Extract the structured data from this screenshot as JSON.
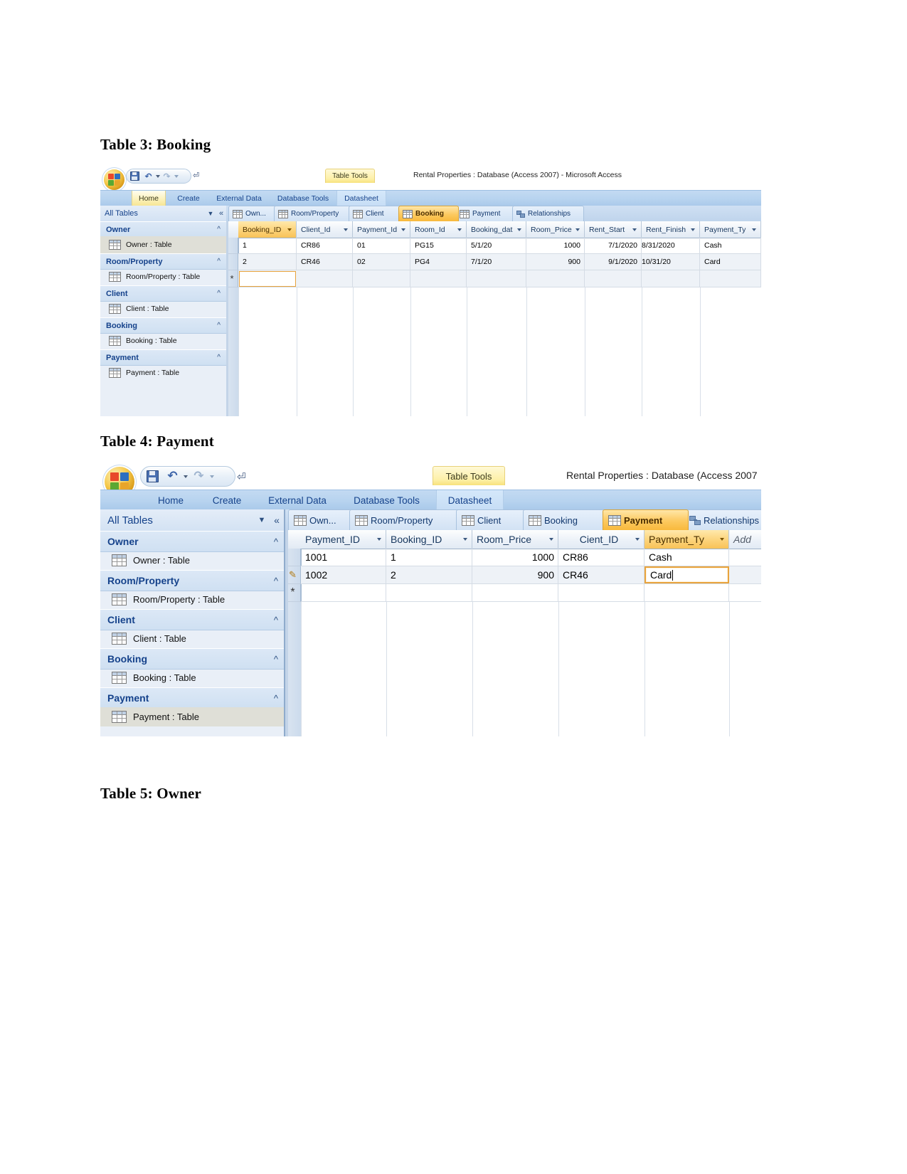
{
  "document": {
    "headings": [
      {
        "id": "heading-3",
        "text": "Table 3: Booking"
      },
      {
        "id": "heading-4",
        "text": "Table 4: Payment"
      },
      {
        "id": "heading-5",
        "text": "Table 5: Owner"
      }
    ]
  },
  "colors": {
    "accent_orange": "#f8b93c",
    "primary_key_header": "#fcd37a",
    "ribbon_blue": "#b7d3ef",
    "nav_group_blue": "#cfe0f2",
    "title_text": "#15428b",
    "editing_border": "#e8a33d"
  },
  "booking_window": {
    "title": "Rental Properties : Database (Access 2007) - Microsoft Access",
    "contextual_tab_group": "Table Tools",
    "quick_access": {
      "save_icon": "save-icon",
      "undo_icon": "undo-icon",
      "redo_icon": "redo-icon",
      "customize_icon": "customize-quick-access-icon"
    },
    "ribbon_tabs": [
      {
        "label": "Home",
        "active": true
      },
      {
        "label": "Create",
        "active": false
      },
      {
        "label": "External Data",
        "active": false
      },
      {
        "label": "Database Tools",
        "active": false
      },
      {
        "label": "Datasheet",
        "active": false,
        "contextual": true
      }
    ],
    "nav_pane": {
      "header": "All Tables",
      "groups": [
        {
          "label": "Owner",
          "items": [
            {
              "label": "Owner : Table",
              "selected": true
            }
          ]
        },
        {
          "label": "Room/Property",
          "items": [
            {
              "label": "Room/Property : Table",
              "selected": false
            }
          ]
        },
        {
          "label": "Client",
          "items": [
            {
              "label": "Client : Table",
              "selected": false
            }
          ]
        },
        {
          "label": "Booking",
          "items": [
            {
              "label": "Booking : Table",
              "selected": false
            }
          ]
        },
        {
          "label": "Payment",
          "items": [
            {
              "label": "Payment : Table",
              "selected": false
            }
          ]
        }
      ]
    },
    "doc_tabs": [
      {
        "label": "Own...",
        "active": false,
        "icon": "table-icon"
      },
      {
        "label": "Room/Property",
        "active": false,
        "icon": "table-icon"
      },
      {
        "label": "Client",
        "active": false,
        "icon": "table-icon"
      },
      {
        "label": "Booking",
        "active": true,
        "icon": "table-icon"
      },
      {
        "label": "Payment",
        "active": false,
        "icon": "table-icon"
      },
      {
        "label": "Relationships",
        "active": false,
        "icon": "relationships-icon"
      }
    ],
    "datasheet": {
      "columns": [
        {
          "name": "Booking_ID",
          "primary_key": true,
          "align": "left"
        },
        {
          "name": "Client_Id",
          "primary_key": false,
          "align": "left"
        },
        {
          "name": "Payment_Id",
          "primary_key": false,
          "align": "left"
        },
        {
          "name": "Room_Id",
          "primary_key": false,
          "align": "left"
        },
        {
          "name": "Booking_dat",
          "primary_key": false,
          "align": "left"
        },
        {
          "name": "Room_Price",
          "primary_key": false,
          "align": "right"
        },
        {
          "name": "Rent_Start",
          "primary_key": false,
          "align": "right"
        },
        {
          "name": "Rent_Finish",
          "primary_key": false,
          "align": "left"
        },
        {
          "name": "Payment_Ty",
          "primary_key": false,
          "align": "left"
        }
      ],
      "rows": [
        [
          "1",
          "CR86",
          "01",
          "PG15",
          "5/1/20",
          "1000",
          "7/1/2020",
          "8/31/2020",
          "Cash"
        ],
        [
          "2",
          "CR46",
          "02",
          "PG4",
          "7/1/20",
          "900",
          "9/1/2020",
          "10/31/20",
          "Card"
        ]
      ],
      "new_row_marker": "*",
      "new_row_focus_column": 0
    }
  },
  "payment_window": {
    "title": "Rental Properties : Database (Access 2007",
    "contextual_tab_group": "Table Tools",
    "quick_access": {
      "save_icon": "save-icon",
      "undo_icon": "undo-icon",
      "redo_icon": "redo-icon",
      "customize_icon": "customize-quick-access-icon"
    },
    "ribbon_tabs": [
      {
        "label": "Home",
        "active": false
      },
      {
        "label": "Create",
        "active": false
      },
      {
        "label": "External Data",
        "active": false
      },
      {
        "label": "Database Tools",
        "active": false
      },
      {
        "label": "Datasheet",
        "active": true,
        "contextual": true
      }
    ],
    "nav_pane": {
      "header": "All Tables",
      "groups": [
        {
          "label": "Owner",
          "items": [
            {
              "label": "Owner : Table",
              "selected": false
            }
          ]
        },
        {
          "label": "Room/Property",
          "items": [
            {
              "label": "Room/Property : Table",
              "selected": false
            }
          ]
        },
        {
          "label": "Client",
          "items": [
            {
              "label": "Client : Table",
              "selected": false
            }
          ]
        },
        {
          "label": "Booking",
          "items": [
            {
              "label": "Booking : Table",
              "selected": false
            }
          ]
        },
        {
          "label": "Payment",
          "items": [
            {
              "label": "Payment : Table",
              "selected": true
            }
          ]
        }
      ]
    },
    "doc_tabs": [
      {
        "label": "Own...",
        "active": false,
        "icon": "table-icon"
      },
      {
        "label": "Room/Property",
        "active": false,
        "icon": "table-icon"
      },
      {
        "label": "Client",
        "active": false,
        "icon": "table-icon"
      },
      {
        "label": "Booking",
        "active": false,
        "icon": "table-icon"
      },
      {
        "label": "Payment",
        "active": true,
        "icon": "table-icon"
      },
      {
        "label": "Relationships",
        "active": false,
        "icon": "relationships-icon"
      }
    ],
    "datasheet": {
      "columns": [
        {
          "name": "Payment_ID",
          "primary_key": false,
          "align": "left"
        },
        {
          "name": "Booking_ID",
          "primary_key": false,
          "align": "left"
        },
        {
          "name": "Room_Price",
          "primary_key": false,
          "align": "right"
        },
        {
          "name": "Cient_ID",
          "primary_key": false,
          "align": "left"
        },
        {
          "name": "Payment_Ty",
          "primary_key": true,
          "align": "left"
        },
        {
          "name": "Add",
          "primary_key": false,
          "align": "left"
        }
      ],
      "rows": [
        [
          "1001",
          "1",
          "1000",
          "CR86",
          "Cash",
          ""
        ],
        [
          "1002",
          "2",
          "900",
          "CR46",
          "Card",
          ""
        ]
      ],
      "new_row_marker": "*",
      "editing_row_marker": "pencil-icon",
      "editing_row": 1,
      "editing_column": 4,
      "editing_value": "Card"
    }
  }
}
